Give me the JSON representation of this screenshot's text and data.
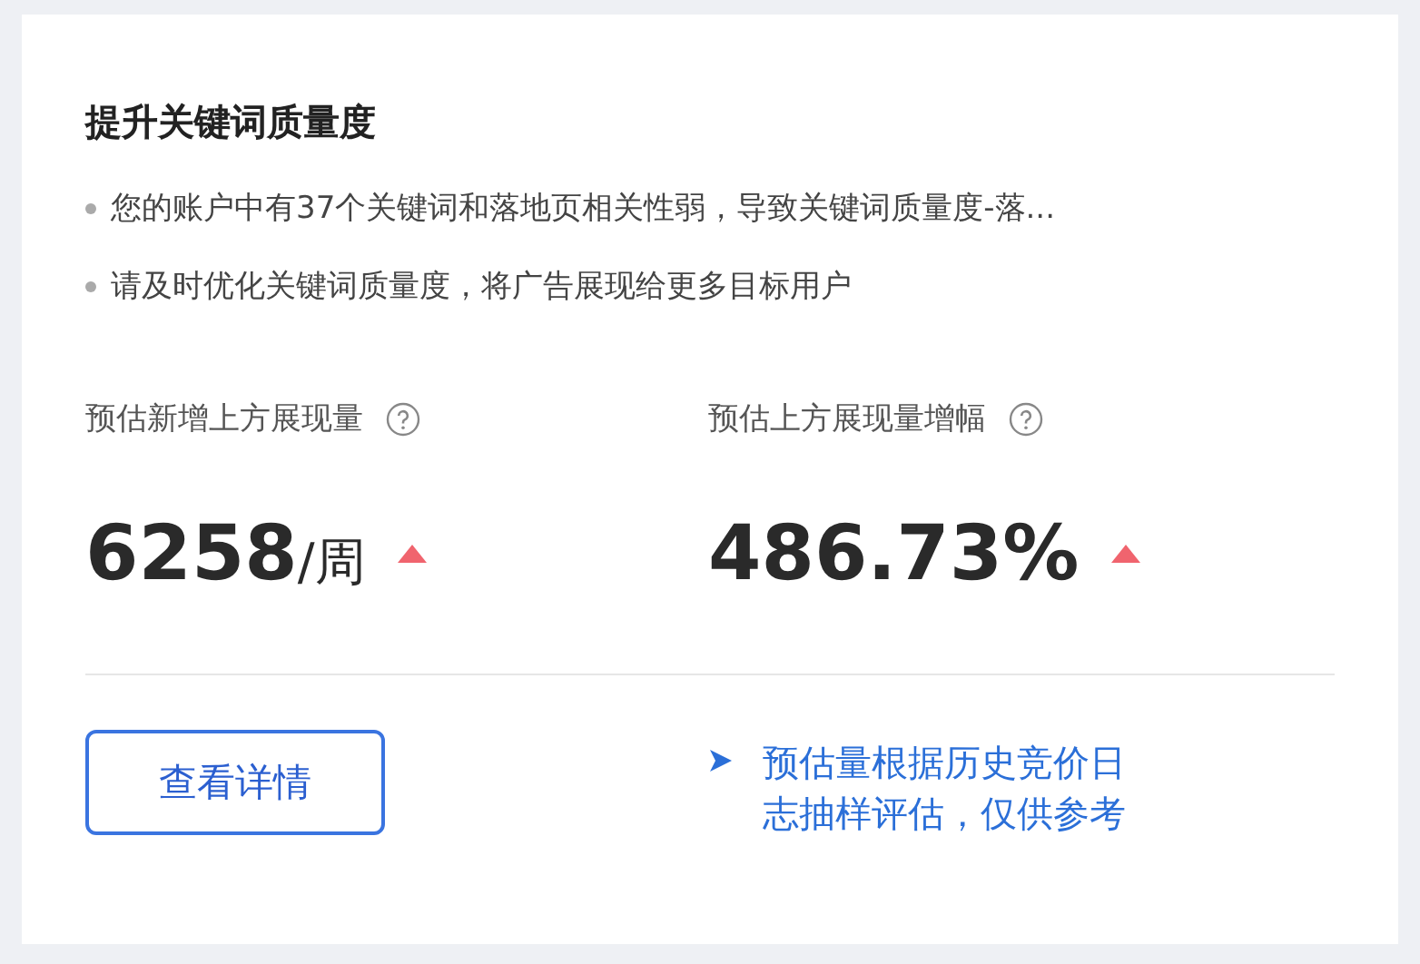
{
  "card": {
    "title": "提升关键词质量度",
    "bullets": [
      "您的账户中有37个关键词和落地页相关性弱，导致关键词质量度-落...",
      "请及时优化关键词质量度，将广告展现给更多目标用户"
    ],
    "metrics": [
      {
        "label": "预估新增上方展现量",
        "value": "6258",
        "unit": "/周",
        "rising": true
      },
      {
        "label": "预估上方展现量增幅",
        "value": "486.73%",
        "rising": true
      }
    ],
    "button": "查看详情",
    "note": "预估量根据历史竞价日志抽样评估，仅供参考"
  }
}
